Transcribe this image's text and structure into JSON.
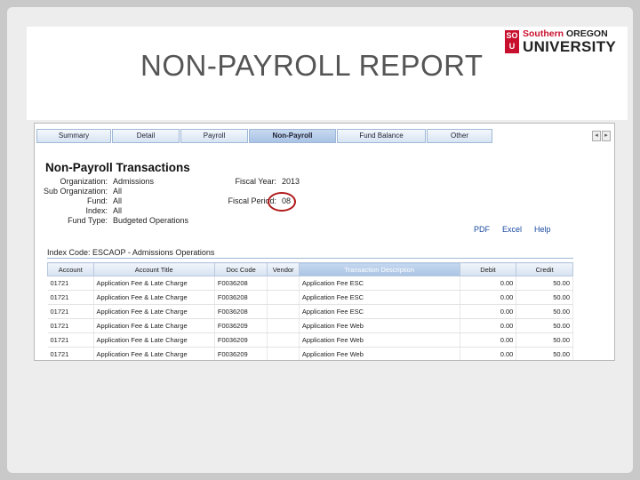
{
  "slide": {
    "title": "NON-PAYROLL REPORT",
    "logo": {
      "badge_line1": "SO",
      "badge_line2": "U",
      "line1_red": "Southern",
      "line1_dark": " OREGON",
      "line2": "UNIVERSITY"
    }
  },
  "tabs": [
    {
      "label": "Summary"
    },
    {
      "label": "Detail"
    },
    {
      "label": "Payroll"
    },
    {
      "label": "Non-Payroll"
    },
    {
      "label": "Fund Balance"
    },
    {
      "label": "Other"
    }
  ],
  "report": {
    "heading": "Non-Payroll Transactions",
    "info_left": [
      {
        "label": "Organization:",
        "value": "Admissions"
      },
      {
        "label": "Sub Organization:",
        "value": "All"
      },
      {
        "label": "Fund:",
        "value": "All"
      },
      {
        "label": "Index:",
        "value": "All"
      },
      {
        "label": "Fund Type:",
        "value": "Budgeted Operations"
      }
    ],
    "fiscal_year_label": "Fiscal Year:",
    "fiscal_year_value": "2013",
    "fiscal_period_label": "Fiscal Period:",
    "fiscal_period_value": "08",
    "links": {
      "pdf": "PDF",
      "excel": "Excel",
      "help": "Help"
    },
    "index_code": "Index Code: ESCAOP - Admissions Operations"
  },
  "table": {
    "headers": [
      "Account",
      "Account Title",
      "Doc Code",
      "Vendor",
      "Transaction Description",
      "Debit",
      "Credit"
    ],
    "rows": [
      [
        "01721",
        "Application Fee & Late Charge",
        "F0036208",
        "",
        "Application Fee ESC",
        "0.00",
        "50.00"
      ],
      [
        "01721",
        "Application Fee & Late Charge",
        "F0036208",
        "",
        "Application Fee ESC",
        "0.00",
        "50.00"
      ],
      [
        "01721",
        "Application Fee & Late Charge",
        "F0036208",
        "",
        "Application Fee ESC",
        "0.00",
        "50.00"
      ],
      [
        "01721",
        "Application Fee & Late Charge",
        "F0036209",
        "",
        "Application Fee Web",
        "0.00",
        "50.00"
      ],
      [
        "01721",
        "Application Fee & Late Charge",
        "F0036209",
        "",
        "Application Fee Web",
        "0.00",
        "50.00"
      ],
      [
        "01721",
        "Application Fee & Late Charge",
        "F0036209",
        "",
        "Application Fee Web",
        "0.00",
        "50.00"
      ]
    ]
  }
}
